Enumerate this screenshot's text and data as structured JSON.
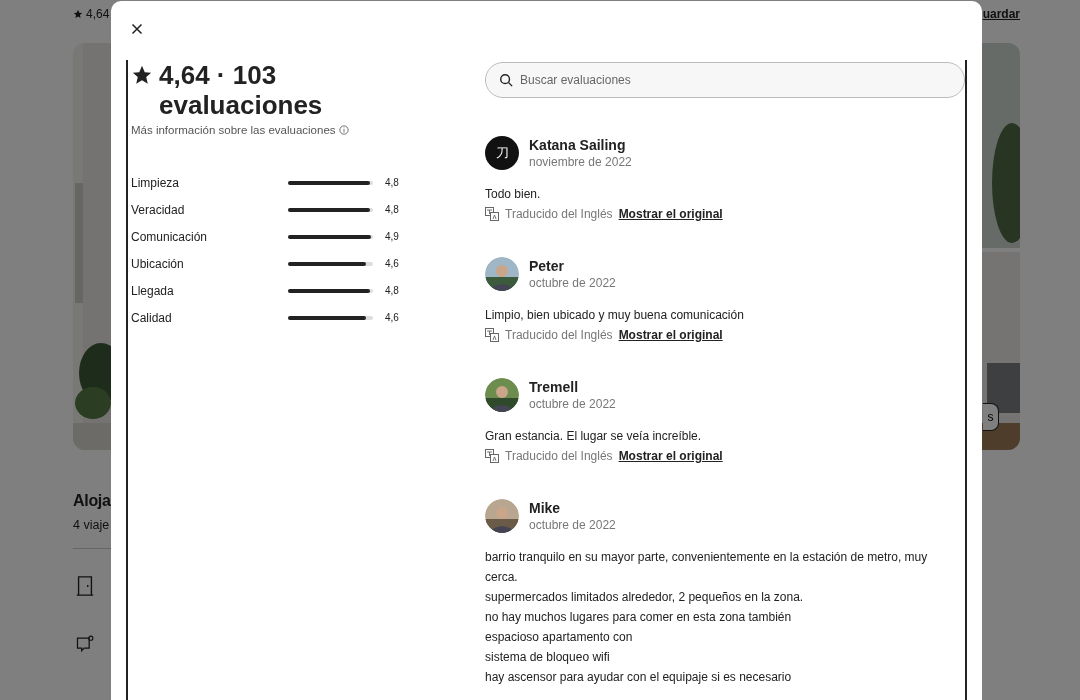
{
  "background": {
    "rating": "4,64",
    "save_link": "uardar",
    "photos_button": "s",
    "title": "Aloja",
    "subtitle": "4 viaje"
  },
  "modal": {
    "heading": "4,64 · 103 evaluaciones",
    "info_link": "Más información sobre las evaluaciones",
    "categories": [
      {
        "label": "Limpieza",
        "level": 0.96,
        "value": "4,8"
      },
      {
        "label": "Veracidad",
        "level": 0.96,
        "value": "4,8"
      },
      {
        "label": "Comunicación",
        "level": 0.98,
        "value": "4,9"
      },
      {
        "label": "Ubicación",
        "level": 0.92,
        "value": "4,6"
      },
      {
        "label": "Llegada",
        "level": 0.96,
        "value": "4,8"
      },
      {
        "label": "Calidad",
        "level": 0.92,
        "value": "4,6"
      }
    ],
    "search": {
      "placeholder": "Buscar evaluaciones"
    },
    "reviews": [
      {
        "name": "Katana Sailing",
        "date": "noviembre de 2022",
        "avatar": {
          "kind": "initial",
          "text": "刀"
        },
        "lines": [
          "Todo bien."
        ],
        "translation": {
          "note": "Traducido del Inglés",
          "link": "Mostrar el original"
        }
      },
      {
        "name": "Peter",
        "date": "octubre de 2022",
        "lines": [
          "Limpio, bien ubicado y muy buena comunicación"
        ],
        "translation": {
          "note": "Traducido del Inglés",
          "link": "Mostrar el original"
        }
      },
      {
        "name": "Tremell",
        "date": "octubre de 2022",
        "lines": [
          "Gran estancia. El lugar se veía increíble."
        ],
        "translation": {
          "note": "Traducido del Inglés",
          "link": "Mostrar el original"
        }
      },
      {
        "name": "Mike",
        "date": "octubre de 2022",
        "lines": [
          "barrio tranquilo en su mayor parte, convenientemente en la estación de metro, muy cerca.",
          "supermercados limitados alrededor, 2 pequeños en la zona.",
          "no hay muchos lugares para comer en esta zona también",
          "espacioso apartamento con",
          "sistema de bloqueo wifi",
          "hay ascensor para ayudar con el equipaje si es necesario"
        ]
      }
    ]
  }
}
